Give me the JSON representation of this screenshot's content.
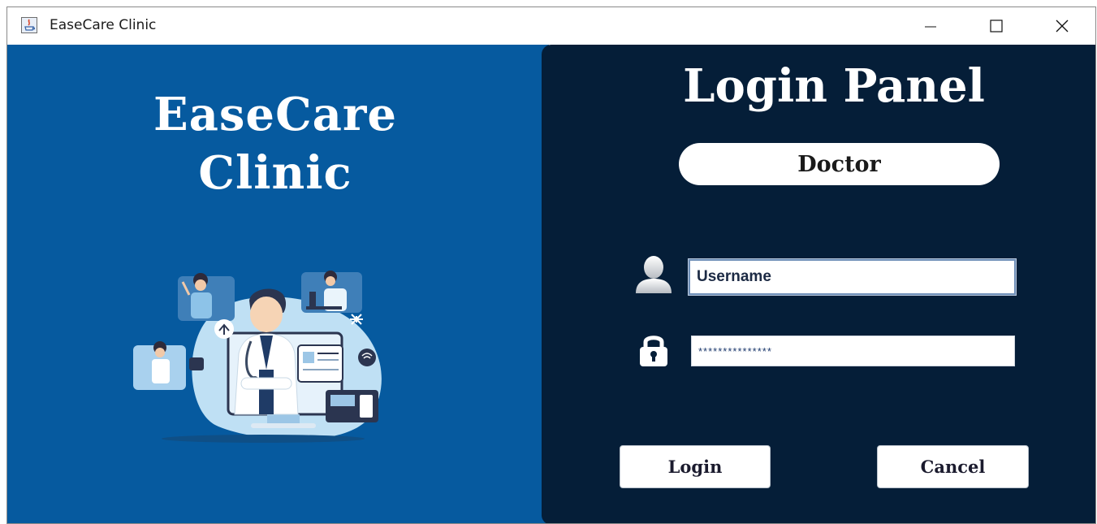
{
  "window": {
    "title": "EaseCare Clinic",
    "controls": [
      "minimize-icon",
      "maximize-icon",
      "close-icon"
    ]
  },
  "brand": {
    "line1": "EaseCare",
    "line2": "Clinic",
    "illustration": "telemedicine-doctors-illustration"
  },
  "login": {
    "title": "Login Panel",
    "role": "Doctor",
    "username_value": "Username",
    "password_value": "***************",
    "login_label": "Login",
    "cancel_label": "Cancel"
  },
  "colors": {
    "left_panel": "#065a9f",
    "right_panel": "#051e38",
    "text_light": "#ffffff"
  }
}
